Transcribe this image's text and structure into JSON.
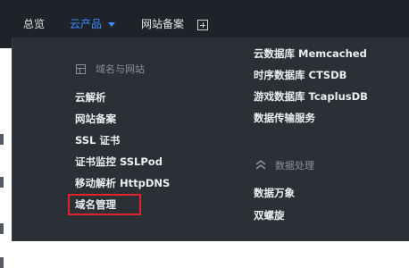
{
  "topnav": {
    "overview": "总览",
    "products": "云产品",
    "icp": "网站备案"
  },
  "domain_group": {
    "title": "域名与网站",
    "items": [
      "云解析",
      "网站备案",
      "SSL 证书",
      "证书监控 SSLPod",
      "移动解析 HttpDNS",
      "域名管理"
    ]
  },
  "database_group": {
    "items": [
      "云数据库 Memcached",
      "时序数据库 CTSDB",
      "游戏数据库 TcaplusDB",
      "数据传输服务"
    ]
  },
  "data_processing_group": {
    "title": "数据处理",
    "items": [
      "数据万象",
      "双螺旋"
    ]
  },
  "colors": {
    "topbar": "#1f2329",
    "panel": "#2b2f36",
    "accent": "#3b8dff",
    "highlight": "#e3232c"
  }
}
